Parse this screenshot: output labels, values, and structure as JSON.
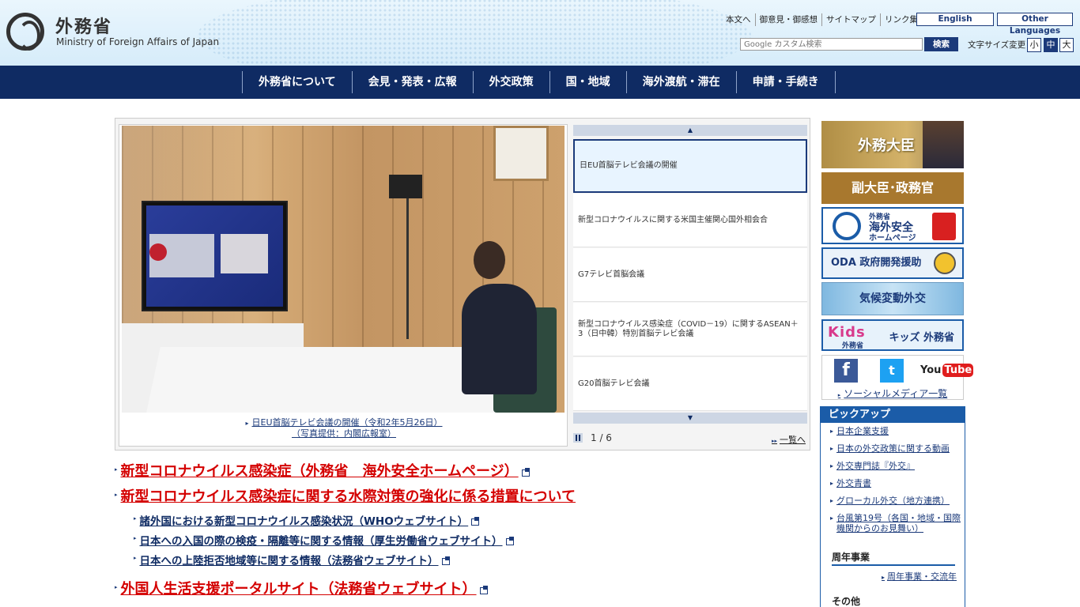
{
  "header": {
    "logo_jp": "外務省",
    "logo_en": "Ministry of Foreign Affairs of Japan",
    "util_links": [
      "本文へ",
      "御意見・御感想",
      "サイトマップ",
      "リンク集"
    ],
    "lang_english": "English",
    "lang_other": "Other Languages",
    "search_placeholder": "Google カスタム検索",
    "search_button": "検索",
    "fontsize_label": "文字サイズ変更",
    "fontsize_small": "小",
    "fontsize_mid": "中",
    "fontsize_large": "大"
  },
  "nav": {
    "items": [
      "外務省について",
      "会見・発表・広報",
      "外交政策",
      "国・地域",
      "海外渡航・滞在",
      "申請・手続き"
    ]
  },
  "carousel": {
    "caption_line1": "日EU首脳テレビ会議の開催（令和2年5月26日）",
    "caption_line2": "（写真提供：内閣広報室）",
    "items": [
      "日EU首脳テレビ会議の開催",
      "新型コロナウイルスに関する米国主催関心国外相会合",
      "G7テレビ首脳会議",
      "新型コロナウイルス感染症（COVID－19）に関するASEAN＋3（日中韓）特別首脳テレビ会議",
      "G20首脳テレビ会議"
    ],
    "counter": "1 / 6",
    "all_link": "一覧へ"
  },
  "headlines": {
    "big1": "新型コロナウイルス感染症（外務省　海外安全ホームページ）",
    "big2": "新型コロナウイルス感染症に関する水際対策の強化に係る措置について",
    "sub1": "諸外国における新型コロナウイルス感染状況（WHOウェブサイト）",
    "sub2": "日本への入国の際の検疫・隔離等に関する情報（厚生労働省ウェブサイト）",
    "sub3": "日本への上陸拒否地域等に関する情報（法務省ウェブサイト）",
    "big3": "外国人生活支援ポータルサイト（法務省ウェブサイト）"
  },
  "sidebar": {
    "minister": "外務大臣",
    "vice": "副大臣･政務官",
    "safety_line1": "外務省",
    "safety_line2": "海外安全",
    "safety_line3": "ホームページ",
    "oda": "ODA 政府開発援助",
    "climate": "気候変動外交",
    "kids_logo": "Kids",
    "kids_sub": "外務省",
    "kids_label": "キッズ 外務省",
    "social_fb": "f",
    "social_tw": "t",
    "social_yt": "You",
    "social_yt2": "Tube",
    "social_link": "ソーシャルメディア一覧"
  },
  "pickup": {
    "title": "ピックアップ",
    "items": [
      "日本企業支援",
      "日本の外交政策に関する動画",
      "外交専門誌『外交』",
      "外交青書",
      "グローカル外交（地方連携）",
      "台風第19号（各国・地域・国際機関からのお見舞い）"
    ],
    "anniv_title": "周年事業",
    "anniv_link": "周年事業・交流年",
    "other_title": "その他"
  },
  "colors": {
    "navy": "#0f2b63",
    "accent_blue": "#1b5ca8",
    "red_headline": "#d40000"
  }
}
